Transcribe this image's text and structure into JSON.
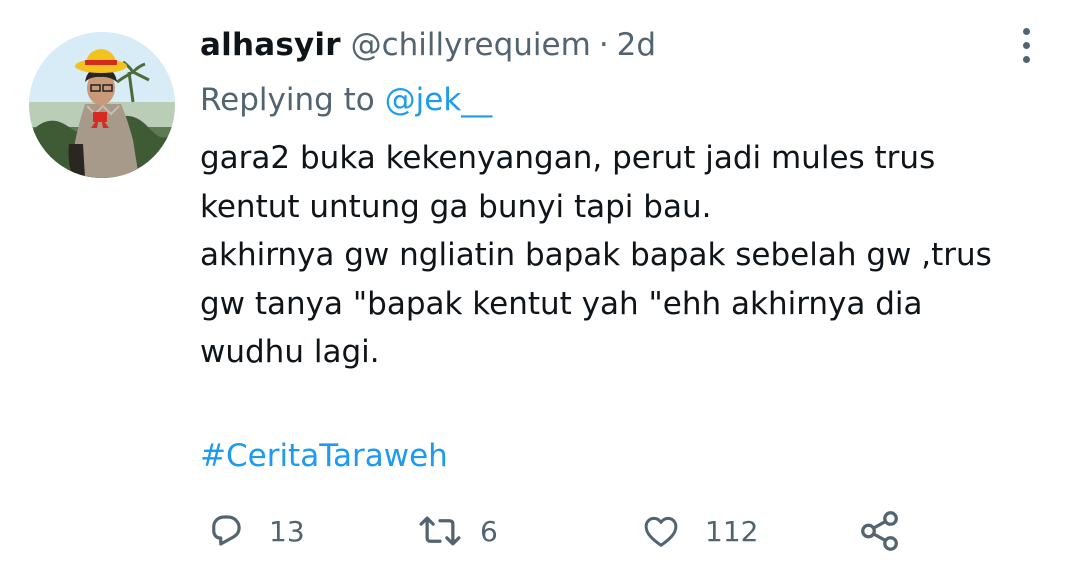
{
  "tweet": {
    "display_name": "alhasyir",
    "handle": "@chillyrequiem",
    "separator": "·",
    "time": "2d",
    "replying_prefix": "Replying to",
    "replying_to": "@jek__",
    "text_lines": [
      "gara2 buka kekenyangan, perut jadi mules trus",
      "kentut untung ga bunyi tapi bau.",
      "akhirnya gw ngliatin bapak bapak sebelah gw ,trus",
      "gw tanya \"bapak kentut yah \"ehh akhirnya dia",
      "wudhu lagi."
    ],
    "hashtag": "#CeritaTaraweh"
  },
  "actions": {
    "reply_count": "13",
    "retweet_count": "6",
    "like_count": "112"
  },
  "icons": {
    "more": "more-vertical-icon",
    "reply": "reply-icon",
    "retweet": "retweet-icon",
    "like": "heart-icon",
    "share": "share-icon"
  },
  "colors": {
    "text": "#0f1419",
    "secondary": "#536471",
    "link": "#1d9bf0"
  }
}
